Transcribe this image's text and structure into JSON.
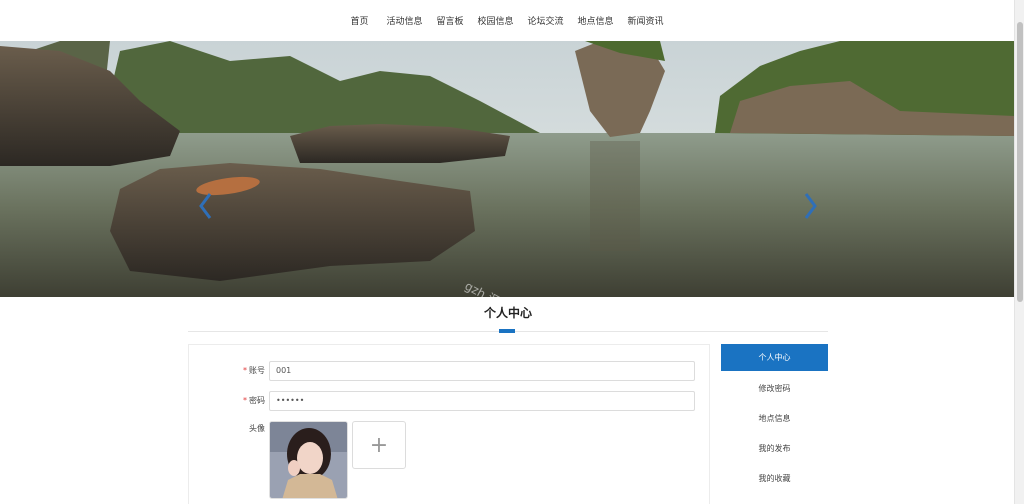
{
  "nav": {
    "items": [
      "首页",
      "活动信息",
      "留言板",
      "校园信息",
      "论坛交流",
      "地点信息",
      "新闻资讯"
    ]
  },
  "banner": {
    "watermark": "gzh 源码好优多",
    "prev_icon": "chevron-left-icon",
    "next_icon": "chevron-right-icon"
  },
  "section": {
    "title": "个人中心"
  },
  "form": {
    "account_label": "账号",
    "account_value": "001",
    "password_label": "密码",
    "password_value": "••••••",
    "avatar_label": "头像",
    "upload_icon": "+",
    "required_mark": "*"
  },
  "side_menu": {
    "items": [
      "个人中心",
      "修改密码",
      "地点信息",
      "我的发布",
      "我的收藏"
    ],
    "active_index": 0
  },
  "colors": {
    "accent": "#1a73c2",
    "required": "#e03b3b"
  }
}
